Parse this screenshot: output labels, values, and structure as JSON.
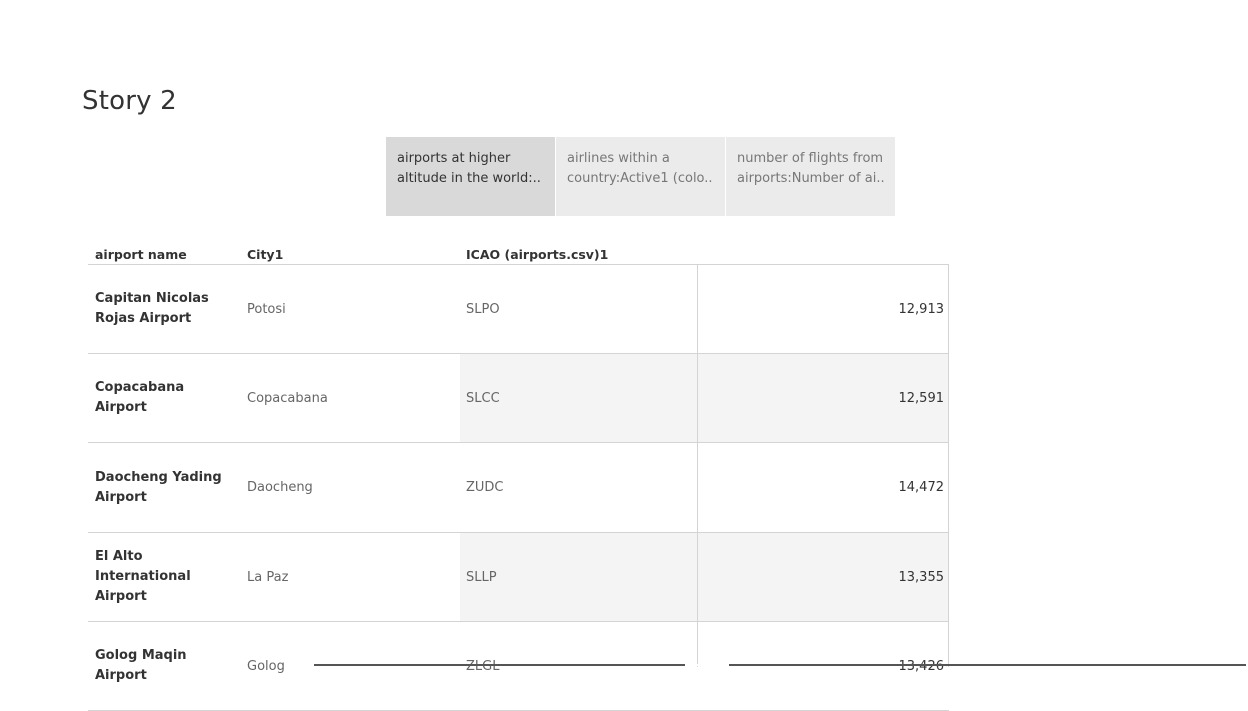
{
  "story": {
    "title": "Story 2"
  },
  "nav_points": [
    {
      "line1": "airports at higher",
      "line2": "altitude in the world:..",
      "active": true
    },
    {
      "line1": "airlines within a",
      "line2": "country:Active1 (colo..",
      "active": false
    },
    {
      "line1": "number of flights from",
      "line2": "airports:Number of ai..",
      "active": false
    }
  ],
  "table": {
    "headers": {
      "airport_name": "airport name",
      "city": "City1",
      "icao": "ICAO (airports.csv)1"
    },
    "rows": [
      {
        "name": "Capitan Nicolas Rojas Airport",
        "city": "Potosi",
        "icao": "SLPO",
        "altitude": "12,913"
      },
      {
        "name": "Copacabana Airport",
        "city": "Copacabana",
        "icao": "SLCC",
        "altitude": "12,591"
      },
      {
        "name": "Daocheng Yading Airport",
        "city": "Daocheng",
        "icao": "ZUDC",
        "altitude": "14,472"
      },
      {
        "name": "El Alto International Airport",
        "city": "La Paz",
        "icao": "SLLP",
        "altitude": "13,355"
      },
      {
        "name": "Golog Maqin Airport",
        "city": "Golog",
        "icao": "ZLGL",
        "altitude": "13,426"
      }
    ]
  },
  "colors": {
    "active_tab": "#d9d9d9",
    "inactive_tab": "#ebebeb",
    "band": "#f4f4f4",
    "grid_line": "#d4d4d4"
  }
}
